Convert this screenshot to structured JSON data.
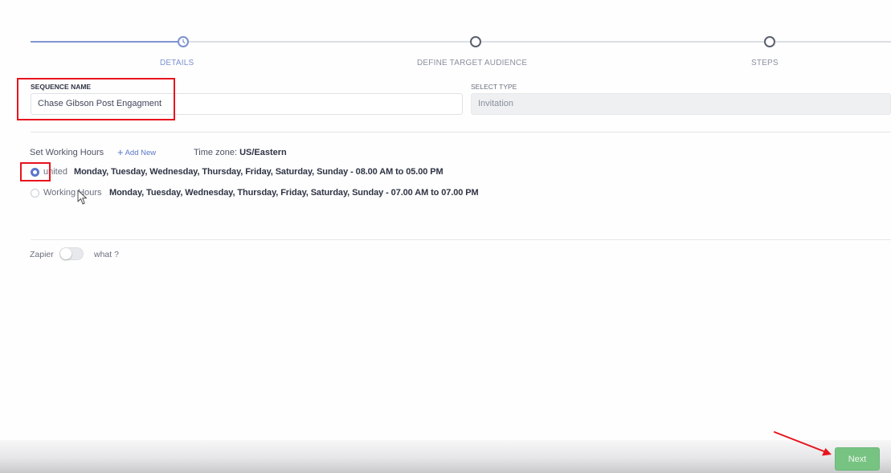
{
  "stepper": {
    "steps": [
      {
        "label": "DETAILS",
        "state": "active"
      },
      {
        "label": "DEFINE TARGET AUDIENCE",
        "state": "pending"
      },
      {
        "label": "STEPS",
        "state": "pending"
      }
    ]
  },
  "form": {
    "sequence_name_label": "SEQUENCE NAME",
    "sequence_name_value": "Chase Gibson Post Engagment",
    "select_type_label": "SELECT TYPE",
    "select_type_value": "Invitation"
  },
  "working_hours": {
    "title": "Set Working Hours",
    "add_new_label": "Add New",
    "timezone_label": "Time zone:",
    "timezone_value": "US/Eastern",
    "options": [
      {
        "name": "united",
        "schedule": "Monday, Tuesday, Wednesday, Thursday, Friday, Saturday, Sunday - 08.00 AM to 05.00 PM",
        "checked": true
      },
      {
        "name": "Working Hours",
        "schedule": "Monday, Tuesday, Wednesday, Thursday, Friday, Saturday, Sunday - 07.00 AM to 07.00 PM",
        "checked": false
      }
    ]
  },
  "zapier": {
    "label": "Zapier",
    "enabled": false,
    "help_label": "what ?"
  },
  "footer": {
    "next_label": "Next"
  },
  "colors": {
    "accent": "#5b76cc",
    "highlight": "#e8141e",
    "next_button": "#77c382"
  },
  "icons": {
    "active_step": "clock-icon",
    "annotation": "red-arrow-icon",
    "pointer": "mouse-cursor-icon"
  }
}
